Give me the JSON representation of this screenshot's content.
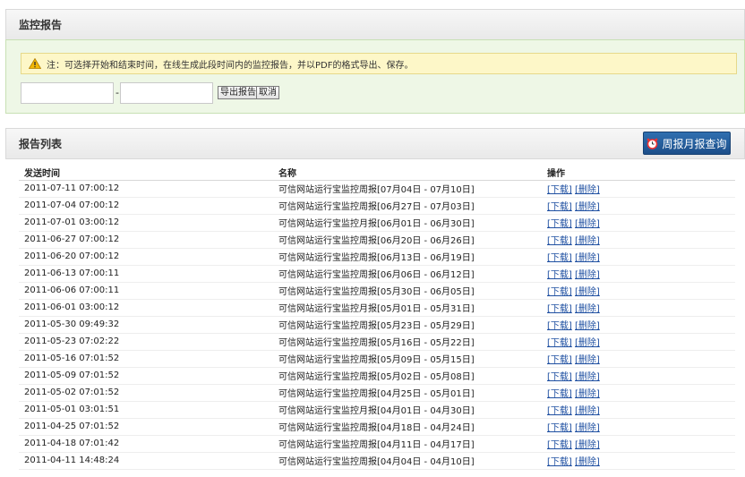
{
  "monitor_section": {
    "title": "监控报告",
    "notice": "注：可选择开始和结束时间，在线生成此段时间内的监控报告，并以PDF的格式导出、保存。",
    "start_date": "",
    "separator": "-",
    "end_date": "",
    "export_label": "导出报告",
    "cancel_label": "取消"
  },
  "report_section": {
    "title": "报告列表",
    "weekly_monthly_button": "周报月报查询",
    "columns": [
      "发送时间",
      "名称",
      "操作"
    ],
    "download_label": "[下载]",
    "delete_label": "[删除]",
    "rows": [
      {
        "time": "2011-07-11 07:00:12",
        "name": "可信网站运行宝监控周报[07月04日 - 07月10日]"
      },
      {
        "time": "2011-07-04 07:00:12",
        "name": "可信网站运行宝监控周报[06月27日 - 07月03日]"
      },
      {
        "time": "2011-07-01 03:00:12",
        "name": "可信网站运行宝监控月报[06月01日 - 06月30日]"
      },
      {
        "time": "2011-06-27 07:00:12",
        "name": "可信网站运行宝监控周报[06月20日 - 06月26日]"
      },
      {
        "time": "2011-06-20 07:00:12",
        "name": "可信网站运行宝监控周报[06月13日 - 06月19日]"
      },
      {
        "time": "2011-06-13 07:00:11",
        "name": "可信网站运行宝监控周报[06月06日 - 06月12日]"
      },
      {
        "time": "2011-06-06 07:00:11",
        "name": "可信网站运行宝监控周报[05月30日 - 06月05日]"
      },
      {
        "time": "2011-06-01 03:00:12",
        "name": "可信网站运行宝监控月报[05月01日 - 05月31日]"
      },
      {
        "time": "2011-05-30 09:49:32",
        "name": "可信网站运行宝监控周报[05月23日 - 05月29日]"
      },
      {
        "time": "2011-05-23 07:02:22",
        "name": "可信网站运行宝监控周报[05月16日 - 05月22日]"
      },
      {
        "time": "2011-05-16 07:01:52",
        "name": "可信网站运行宝监控周报[05月09日 - 05月15日]"
      },
      {
        "time": "2011-05-09 07:01:52",
        "name": "可信网站运行宝监控周报[05月02日 - 05月08日]"
      },
      {
        "time": "2011-05-02 07:01:52",
        "name": "可信网站运行宝监控周报[04月25日 - 05月01日]"
      },
      {
        "time": "2011-05-01 03:01:51",
        "name": "可信网站运行宝监控月报[04月01日 - 04月30日]"
      },
      {
        "time": "2011-04-25 07:01:52",
        "name": "可信网站运行宝监控周报[04月18日 - 04月24日]"
      },
      {
        "time": "2011-04-18 07:01:42",
        "name": "可信网站运行宝监控周报[04月11日 - 04月17日]"
      },
      {
        "time": "2011-04-11 14:48:24",
        "name": "可信网站运行宝监控周报[04月04日 - 04月10日]"
      }
    ]
  },
  "colors": {
    "notice_bg": "#fdf7c8",
    "panel_bg": "#eef7e6",
    "button_blue": "#1d4f8a",
    "link_blue": "#1e4fa1"
  },
  "icons": {
    "notice": "warning-triangle-icon",
    "weekly_button": "alarm-clock-icon"
  }
}
